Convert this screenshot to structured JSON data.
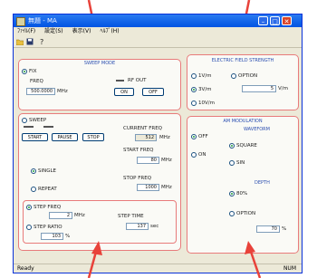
{
  "window": {
    "title": "無題 - MA",
    "minimize": "–",
    "maximize": "□",
    "close": "✕"
  },
  "menu": [
    "ﾌｧｲﾙ(F)",
    "設定(S)",
    "表示(V)",
    "ﾍﾙﾌﾟ(H)"
  ],
  "sweep_mode": {
    "title": "SWEEP MODE",
    "option": "FIX",
    "freq_label": "FREQ",
    "freq_value": "500.0000",
    "freq_unit": "MHz",
    "rfout_label": "RF OUT",
    "on_label": "ON",
    "off_label": "OFF"
  },
  "sweep": {
    "option": "SWEEP",
    "current_label": "CURRENT FREQ",
    "current_value": "512",
    "current_unit": "MHz",
    "start_btn": "START",
    "pause_btn": "PAUSE",
    "stop_btn": "STOP",
    "start_freq_label": "START FREQ",
    "start_freq_value": "80",
    "start_freq_unit": "MHz",
    "stop_freq_label": "STOP FREQ",
    "stop_freq_value": "1000",
    "stop_freq_unit": "MHz",
    "single": "SINGLE",
    "repeat": "REPEAT",
    "step_freq_option": "STEP FREQ",
    "step_freq_value": "2",
    "step_freq_unit": "MHz",
    "step_ratio_option": "STEP RATIO",
    "step_ratio_value": "103",
    "step_ratio_unit": "%",
    "step_time_label": "STEP TIME",
    "step_time_value": "137",
    "step_time_unit": "sec"
  },
  "field_strength": {
    "title": "ELECTRIC FIELD STRENGTH",
    "opt1": "1V/m",
    "opt2": "3V/m",
    "opt3": "10V/m",
    "option": "OPTION",
    "option_value": "5",
    "option_unit": "V/m"
  },
  "am_modulation": {
    "title": "AM MODULATION",
    "off": "OFF",
    "on": "ON",
    "waveform_label": "WAVEFORM",
    "square": "SQUARE",
    "sin": "SIN",
    "depth_label": "DEPTH",
    "depth80": "80%",
    "option": "OPTION",
    "option_value": "70",
    "option_unit": "%"
  },
  "status": {
    "left": "Ready",
    "right": "NUM"
  },
  "colors": {
    "title_blue": "#0054e3",
    "close_red": "#d9452a",
    "panel_border": "#e87b7b",
    "arrow": "#e8423a"
  }
}
